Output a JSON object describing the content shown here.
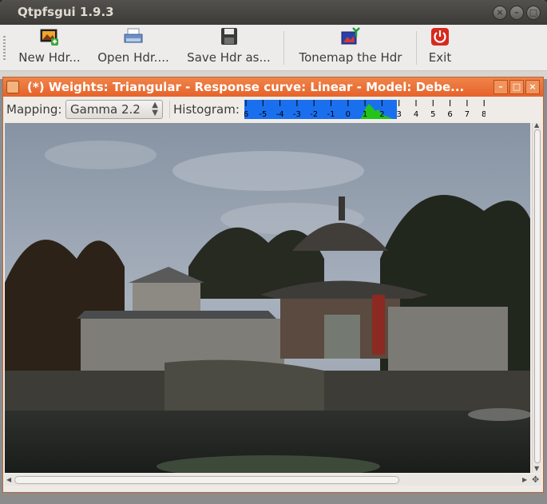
{
  "app": {
    "title": "Qtpfsgui 1.9.3"
  },
  "window_buttons": {
    "close": "×",
    "minimize": "–",
    "maximize": "□"
  },
  "toolbar": {
    "new_hdr": "New Hdr...",
    "open_hdr": "Open Hdr....",
    "save_hdr": "Save Hdr as...",
    "tonemap": "Tonemap the Hdr",
    "exit": "Exit"
  },
  "subwindow": {
    "title": "(*) Weights: Triangular - Response curve: Linear - Model: Debe...",
    "buttons": {
      "minimize": "–",
      "maximize": "□",
      "close": "×"
    }
  },
  "controls": {
    "mapping_label": "Mapping:",
    "mapping_value": "Gamma 2.2",
    "histogram_label": "Histogram:",
    "histogram_ticks": [
      "6",
      "-5",
      "-4",
      "-3",
      "-2",
      "-1",
      "0",
      "1",
      "2",
      "3",
      "4",
      "5",
      "6",
      "7",
      "8"
    ]
  },
  "colors": {
    "accent_orange": "#e5632b",
    "histogram_range": "#1a6fef",
    "histogram_peak": "#22c41a"
  },
  "icons": {
    "new": "new-hdr-icon",
    "open": "open-hdr-icon",
    "save": "save-icon",
    "tonemap": "tonemap-icon",
    "exit": "power-icon"
  },
  "image": {
    "subject": "Chinese pavilion by a pond"
  }
}
